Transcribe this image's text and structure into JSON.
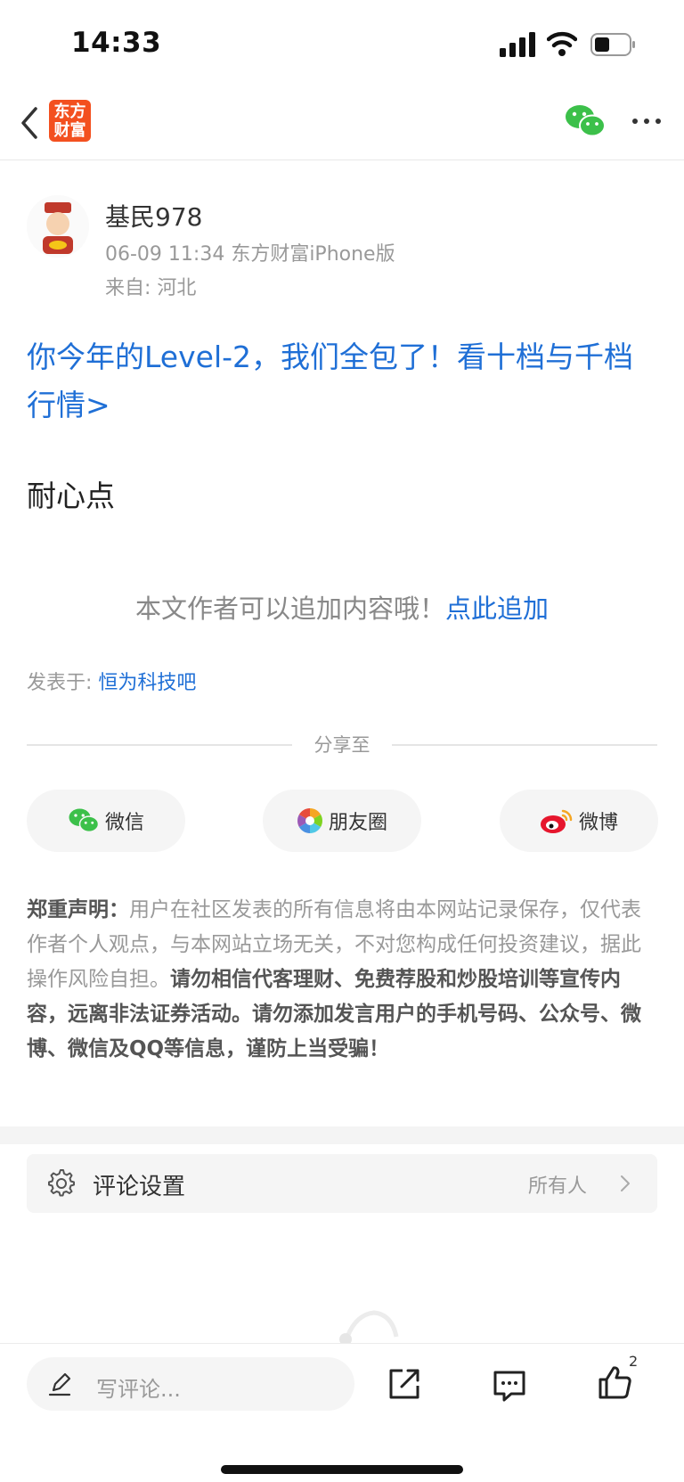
{
  "status": {
    "time": "14:33"
  },
  "nav": {
    "logo_line1": "东方",
    "logo_line2": "财富"
  },
  "author": {
    "name": "基民978",
    "meta": "06-09 11:34 东方财富iPhone版",
    "location": "来自: 河北"
  },
  "promo": {
    "text": "你今年的Level-2，我们全包了！看十档与千档行情>"
  },
  "post": {
    "body": "耐心点"
  },
  "append": {
    "text": "本文作者可以追加内容哦！",
    "link": "点此追加"
  },
  "posted_in": {
    "label": "发表于: ",
    "bar": "恒为科技吧"
  },
  "share": {
    "title": "分享至",
    "wechat": "微信",
    "moments": "朋友圈",
    "weibo": "微博"
  },
  "disclaimer": {
    "label": "郑重声明：",
    "normal": "用户在社区发表的所有信息将由本网站记录保存，仅代表作者个人观点，与本网站立场无关，不对您构成任何投资建议，据此操作风险自担。",
    "bold": "请勿相信代客理财、免费荐股和炒股培训等宣传内容，远离非法证券活动。请勿添加发言用户的手机号码、公众号、微博、微信及QQ等信息，谨防上当受骗！"
  },
  "comment_settings": {
    "label": "评论设置",
    "value": "所有人"
  },
  "bottom": {
    "placeholder": "写评论...",
    "like_count": "2"
  },
  "colors": {
    "link_blue": "#1f6fd6",
    "brand_orange": "#f3501f",
    "wechat_green": "#3cc04a",
    "weibo_red": "#e6162d"
  },
  "icons": [
    "back-icon",
    "wechat-icon",
    "more-icon",
    "moments-icon",
    "weibo-icon",
    "gear-icon",
    "chevron-right-icon",
    "pen-icon",
    "share-icon",
    "comment-icon",
    "like-icon"
  ]
}
